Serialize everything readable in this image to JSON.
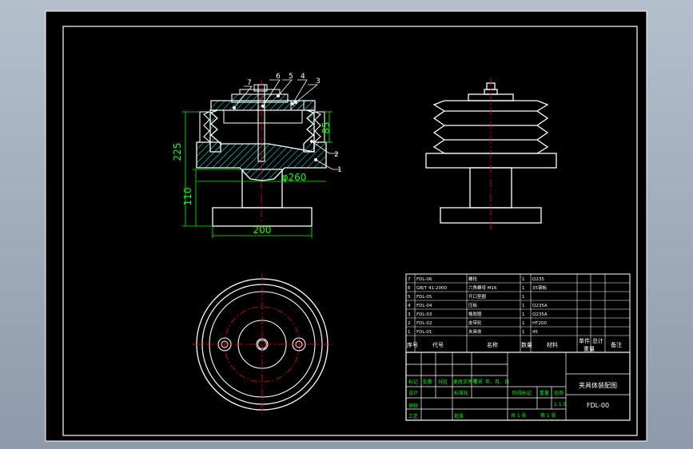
{
  "sheet": {
    "background_color": "#000000",
    "line_color": "#ffffff",
    "hatch_color": "#00ffff",
    "dimension_color": "#00ff00",
    "centerline_color": "#ff0000"
  },
  "dimensions": {
    "total_height": "225",
    "base_height": "110",
    "base_width": "200",
    "diameter": "φ260",
    "groove_height": "85"
  },
  "balloons": [
    "7",
    "6",
    "5",
    "4",
    "3",
    "2",
    "1"
  ],
  "bom": {
    "rows": [
      {
        "no": "7",
        "code": "FDL-06",
        "name": "螺栓",
        "qty": "1",
        "material": "Q235"
      },
      {
        "no": "6",
        "code": "GB/T 41-2000",
        "name": "六角螺母 M16",
        "qty": "1",
        "material": "35钢板"
      },
      {
        "no": "5",
        "code": "FDL-05",
        "name": "开口垫圈",
        "qty": "1",
        "material": ""
      },
      {
        "no": "4",
        "code": "FDL-04",
        "name": "压板",
        "qty": "1",
        "material": "Q235A"
      },
      {
        "no": "3",
        "code": "FDL-03",
        "name": "橡胶圈",
        "qty": "1",
        "material": "Q235A"
      },
      {
        "no": "2",
        "code": "FDL-02",
        "name": "皮带轮",
        "qty": "1",
        "material": "HT200"
      },
      {
        "no": "1",
        "code": "FDL-01",
        "name": "夹具体",
        "qty": "1",
        "material": "45"
      }
    ],
    "header": {
      "no": "序号",
      "code": "代号",
      "name": "名称",
      "qty": "数量",
      "material": "材料",
      "unit_weight": "单件",
      "total_weight": "总计",
      "weight": "重量",
      "remark": "备注"
    }
  },
  "title_block": {
    "drawing_title": "夹具体装配图",
    "drawing_code": "FDL-00",
    "labels": {
      "mark": "标记",
      "count": "处数",
      "zone": "分区",
      "change_doc": "更改文件号",
      "signature": "签名",
      "date": "年、月、日",
      "design": "设计",
      "standardize": "标准化",
      "review": "审核",
      "process": "工艺",
      "approve": "批准",
      "stage_mark": "阶段标记",
      "weight": "重量",
      "scale": "比例"
    },
    "scale_value": "1:1.5",
    "sheet_total": "共 1 张",
    "sheet_no": "第 1 张"
  }
}
